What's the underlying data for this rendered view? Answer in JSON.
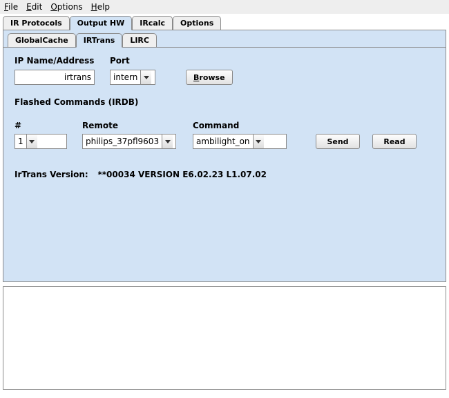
{
  "menu": {
    "file": "File",
    "edit": "Edit",
    "options": "Options",
    "help": "Help"
  },
  "outer_tabs": {
    "ir_protocols": "IR Protocols",
    "output_hw": "Output HW",
    "ircalc": "IRcalc",
    "options": "Options"
  },
  "inner_tabs": {
    "globalcache": "GlobalCache",
    "irtrans": "IRTrans",
    "lirc": "LIRC"
  },
  "ip_section": {
    "ip_label": "IP Name/Address",
    "port_label": "Port",
    "ip_value": "irtrans",
    "port_value": "intern",
    "browse": "Browse"
  },
  "flashed": {
    "title": "Flashed Commands (IRDB)",
    "num_label": "#",
    "remote_label": "Remote",
    "command_label": "Command",
    "num_value": "1",
    "remote_value": "philips_37pfl9603",
    "command_value": "ambilight_on",
    "send": "Send",
    "read": "Read"
  },
  "version": {
    "label": "IrTrans Version:",
    "value": "**00034 VERSION E6.02.23 L1.07.02"
  }
}
